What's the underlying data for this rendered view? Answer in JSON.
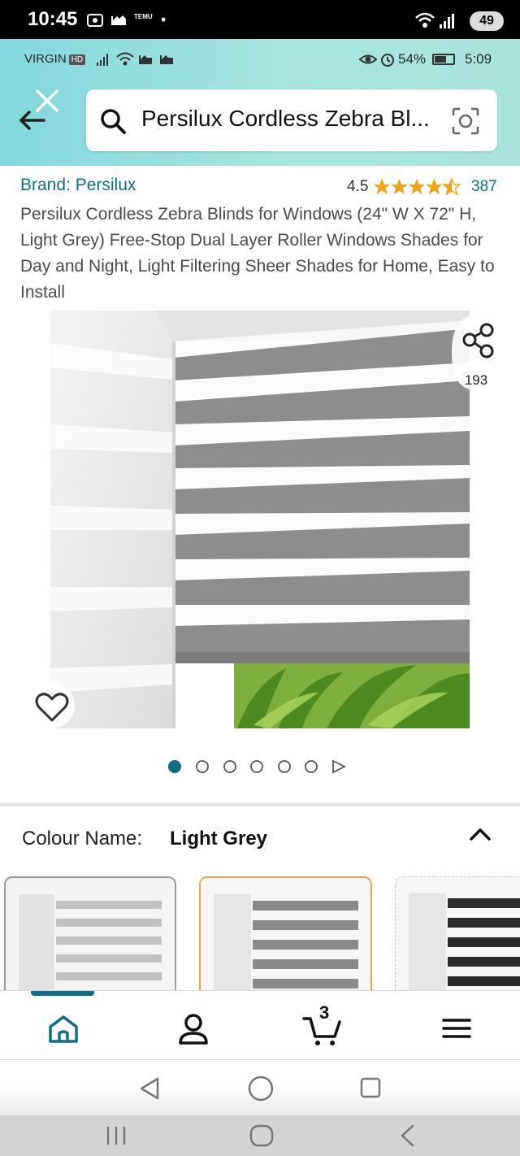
{
  "outer_status_bar": {
    "time": "10:45",
    "temu_label": "TEMU",
    "battery": "49"
  },
  "inner_status_bar": {
    "carrier": "VIRGIN",
    "hd_badge": "HD",
    "battery_percent": "54%",
    "time": "5:09"
  },
  "search": {
    "query": "Persilux Cordless Zebra Bl..."
  },
  "product": {
    "brand": "Brand: Persilux",
    "rating": "4.5",
    "rating_count": "387",
    "title": "Persilux Cordless Zebra Blinds for Windows (24\" W X 72\" H, Light Grey) Free-Stop Dual Layer Roller Windows Shades for Day and Night, Light Filtering Sheer Shades for Home, Easy to Install",
    "share_count": "193"
  },
  "carousel": {
    "total_dots": 6,
    "active_index": 0
  },
  "colour": {
    "label": "Colour Name:",
    "value": "Light Grey",
    "swatches": [
      "Light Grey",
      "Grey",
      "Black"
    ],
    "selected_border": "#e3a94b"
  },
  "bottom_nav": {
    "cart_count": "3",
    "accent": "#0f6f80"
  },
  "colors": {
    "link": "#0f6f80",
    "star": "#f0a31c",
    "header_start": "#82d8dc",
    "header_end": "#a9e4dc"
  }
}
